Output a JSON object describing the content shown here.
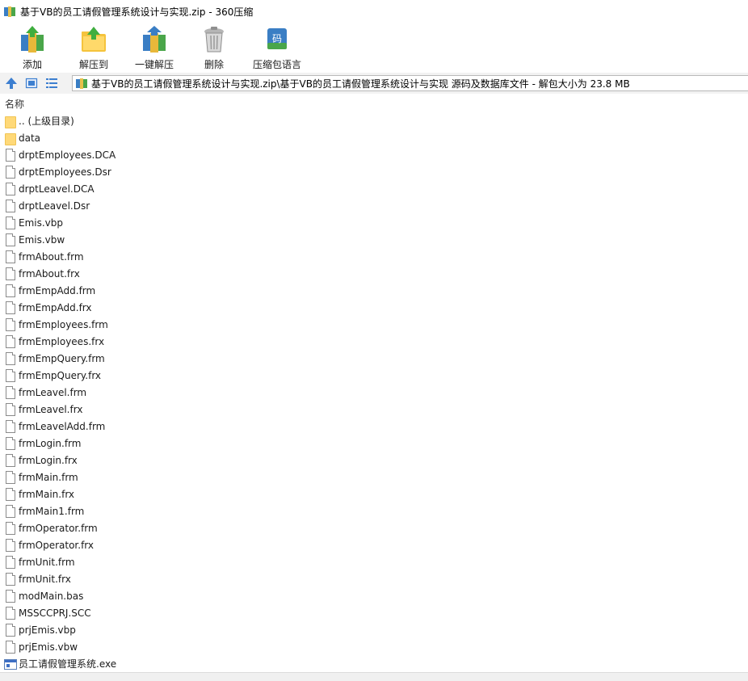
{
  "window": {
    "title": "基于VB的员工请假管理系统设计与实现.zip - 360压缩"
  },
  "toolbar": {
    "items": [
      {
        "label": "添加",
        "icon": "add-archive-icon"
      },
      {
        "label": "解压到",
        "icon": "extract-to-icon"
      },
      {
        "label": "一键解压",
        "icon": "one-click-extract-icon"
      },
      {
        "label": "删除",
        "icon": "delete-icon"
      },
      {
        "label": "压缩包语言",
        "icon": "archive-language-icon"
      }
    ]
  },
  "nav": {
    "up_icon": "up-arrow-icon",
    "thumb_view_icon": "thumbnail-view-icon",
    "list_view_icon": "list-view-icon"
  },
  "address": {
    "path": "基于VB的员工请假管理系统设计与实现.zip\\基于VB的员工请假管理系统设计与实现 源码及数据库文件 - 解包大小为 23.8 MB"
  },
  "list": {
    "column_name": "名称",
    "rows": [
      {
        "name": ".. (上级目录)",
        "type": "folder"
      },
      {
        "name": "data",
        "type": "folder"
      },
      {
        "name": "drptEmployees.DCA",
        "type": "file"
      },
      {
        "name": "drptEmployees.Dsr",
        "type": "file"
      },
      {
        "name": "drptLeavel.DCA",
        "type": "file"
      },
      {
        "name": "drptLeavel.Dsr",
        "type": "file"
      },
      {
        "name": "Emis.vbp",
        "type": "file"
      },
      {
        "name": "Emis.vbw",
        "type": "file"
      },
      {
        "name": "frmAbout.frm",
        "type": "file"
      },
      {
        "name": "frmAbout.frx",
        "type": "file"
      },
      {
        "name": "frmEmpAdd.frm",
        "type": "file"
      },
      {
        "name": "frmEmpAdd.frx",
        "type": "file"
      },
      {
        "name": "frmEmployees.frm",
        "type": "file"
      },
      {
        "name": "frmEmployees.frx",
        "type": "file"
      },
      {
        "name": "frmEmpQuery.frm",
        "type": "file"
      },
      {
        "name": "frmEmpQuery.frx",
        "type": "file"
      },
      {
        "name": "frmLeavel.frm",
        "type": "file"
      },
      {
        "name": "frmLeavel.frx",
        "type": "file"
      },
      {
        "name": "frmLeavelAdd.frm",
        "type": "file"
      },
      {
        "name": "frmLogin.frm",
        "type": "file"
      },
      {
        "name": "frmLogin.frx",
        "type": "file"
      },
      {
        "name": "frmMain.frm",
        "type": "file"
      },
      {
        "name": "frmMain.frx",
        "type": "file"
      },
      {
        "name": "frmMain1.frm",
        "type": "file"
      },
      {
        "name": "frmOperator.frm",
        "type": "file"
      },
      {
        "name": "frmOperator.frx",
        "type": "file"
      },
      {
        "name": "frmUnit.frm",
        "type": "file"
      },
      {
        "name": "frmUnit.frx",
        "type": "file"
      },
      {
        "name": "modMain.bas",
        "type": "file"
      },
      {
        "name": "MSSCCPRJ.SCC",
        "type": "file"
      },
      {
        "name": "prjEmis.vbp",
        "type": "file"
      },
      {
        "name": "prjEmis.vbw",
        "type": "file"
      },
      {
        "name": "员工请假管理系统.exe",
        "type": "exe"
      }
    ]
  },
  "colors": {
    "nav_background": "#f2f2f2",
    "accent_blue": "#3d6fc4",
    "folder_yellow": "#ffd978"
  }
}
